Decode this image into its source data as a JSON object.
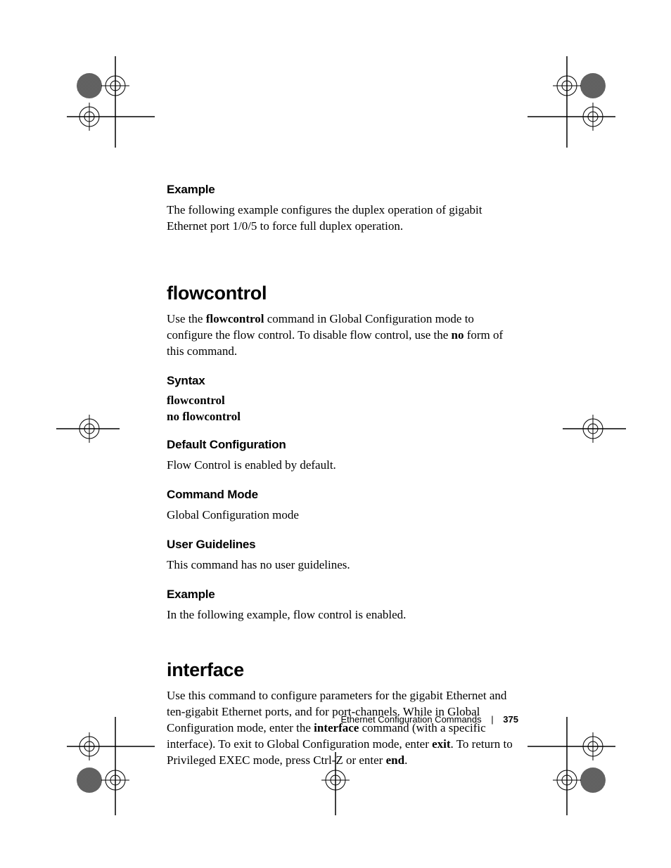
{
  "sec1": {
    "h_example": "Example",
    "p_example": "The following example configures the duplex operation of gigabit Ethernet port 1/0/5 to force full duplex operation."
  },
  "flowcontrol": {
    "title": "flowcontrol",
    "intro_a": "Use the ",
    "intro_b": "flowcontrol",
    "intro_c": " command in Global Configuration mode to configure the flow control. To disable flow control, use the ",
    "intro_d": "no",
    "intro_e": " form of this command.",
    "h_syntax": "Syntax",
    "syntax1": "flowcontrol",
    "syntax2": "no flowcontrol",
    "h_default": "Default Configuration",
    "p_default": "Flow Control is enabled by default.",
    "h_mode": "Command Mode",
    "p_mode": "Global Configuration mode",
    "h_guidelines": "User Guidelines",
    "p_guidelines": "This command has no user guidelines.",
    "h_example": "Example",
    "p_example": "In the following example, flow control is enabled."
  },
  "interface": {
    "title": "interface",
    "p_a": "Use this command to configure parameters for the gigabit Ethernet and ten-gigabit Ethernet ports, and for port-channels. While in Global Configuration mode, enter the ",
    "p_b": "interface",
    "p_c": " command (with a specific interface). To exit to Global Configuration mode, enter ",
    "p_d": "exit",
    "p_e": ". To return to Privileged EXEC mode, press Ctrl-Z or enter ",
    "p_f": "end",
    "p_g": "."
  },
  "footer": {
    "title": "Ethernet Configuration Commands",
    "sep": "|",
    "page": "375"
  }
}
